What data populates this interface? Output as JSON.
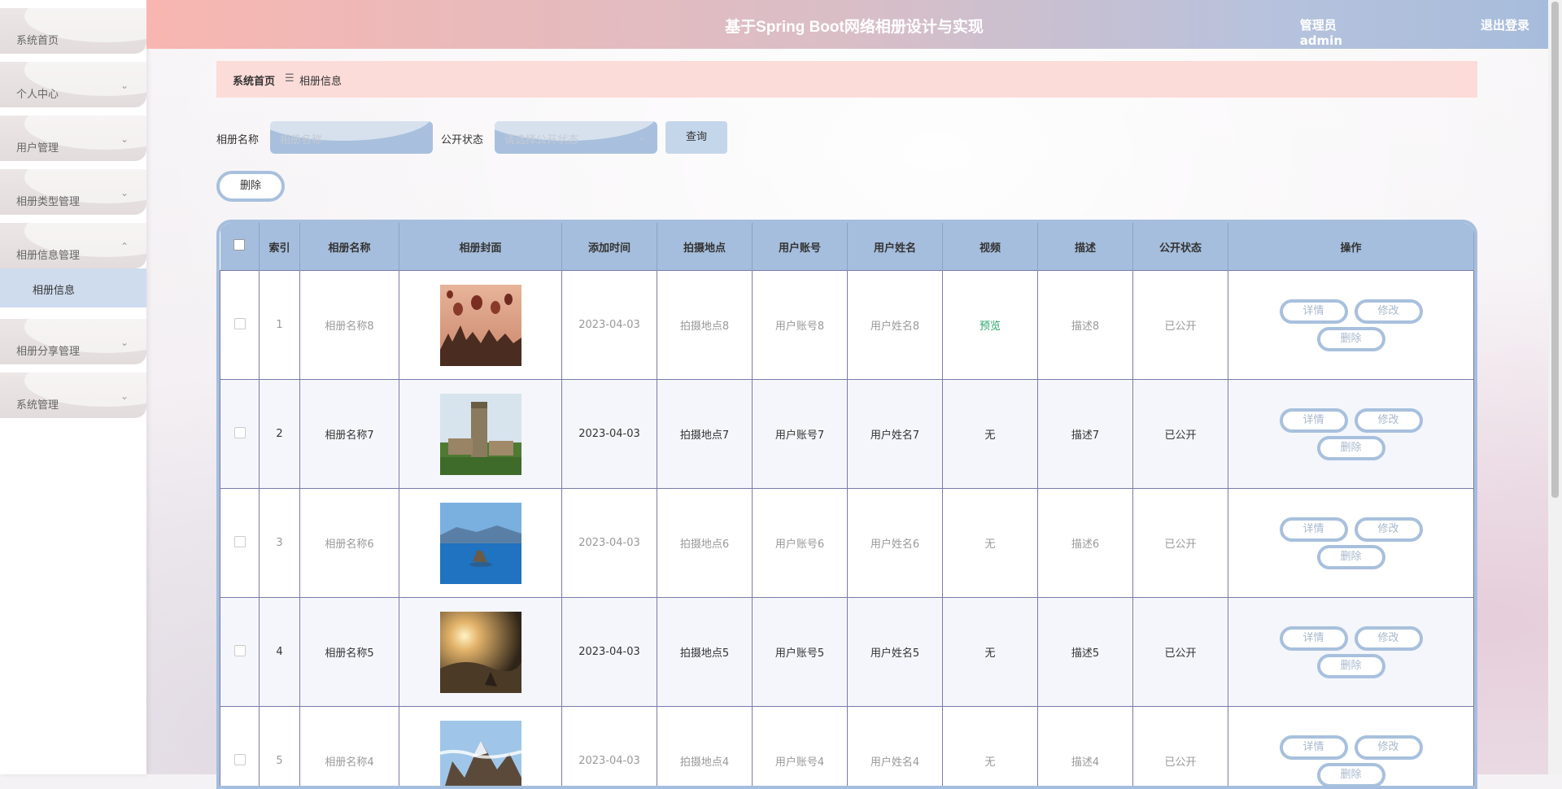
{
  "header": {
    "title": "基于Spring Boot网络相册设计与实现",
    "user": "管理员 admin",
    "logout": "退出登录"
  },
  "sidebar": {
    "items": [
      {
        "label": "系统首页",
        "chevron": ""
      },
      {
        "label": "个人中心",
        "chevron": "⌄"
      },
      {
        "label": "用户管理",
        "chevron": "⌄"
      },
      {
        "label": "相册类型管理",
        "chevron": "⌄"
      },
      {
        "label": "相册信息管理",
        "chevron": "⌃"
      },
      {
        "label": "相册分享管理",
        "chevron": "⌄"
      },
      {
        "label": "系统管理",
        "chevron": "⌄"
      }
    ],
    "sub_item": "相册信息"
  },
  "breadcrumb": {
    "home": "系统首页",
    "sep": "☰",
    "current": "相册信息"
  },
  "search": {
    "name_label": "相册名称",
    "name_placeholder": "相册名称",
    "status_label": "公开状态",
    "status_placeholder": "请选择公开状态",
    "query_button": "查询"
  },
  "toolbar": {
    "delete_button": "删除"
  },
  "table": {
    "headers": [
      "",
      "索引",
      "相册名称",
      "相册封面",
      "添加时间",
      "拍摄地点",
      "用户账号",
      "用户姓名",
      "视频",
      "描述",
      "公开状态",
      "操作"
    ],
    "rows": [
      {
        "index": "1",
        "name": "相册名称8",
        "time": "2023-04-03",
        "place": "拍摄地点8",
        "account": "用户账号8",
        "username": "用户姓名8",
        "video": "预览",
        "desc": "描述8",
        "status": "已公开",
        "cover": "balloons"
      },
      {
        "index": "2",
        "name": "相册名称7",
        "time": "2023-04-03",
        "place": "拍摄地点7",
        "account": "用户账号7",
        "username": "用户姓名7",
        "video": "无",
        "desc": "描述7",
        "status": "已公开",
        "cover": "tower"
      },
      {
        "index": "3",
        "name": "相册名称6",
        "time": "2023-04-03",
        "place": "拍摄地点6",
        "account": "用户账号6",
        "username": "用户姓名6",
        "video": "无",
        "desc": "描述6",
        "status": "已公开",
        "cover": "lake"
      },
      {
        "index": "4",
        "name": "相册名称5",
        "time": "2023-04-03",
        "place": "拍摄地点5",
        "account": "用户账号5",
        "username": "用户姓名5",
        "video": "无",
        "desc": "描述5",
        "status": "已公开",
        "cover": "sunrise"
      },
      {
        "index": "5",
        "name": "相册名称4",
        "time": "2023-04-03",
        "place": "拍摄地点4",
        "account": "用户账号4",
        "username": "用户姓名4",
        "video": "无",
        "desc": "描述4",
        "status": "已公开",
        "cover": "mountain"
      }
    ],
    "actions": {
      "detail": "详情",
      "edit": "修改",
      "delete": "删除"
    }
  }
}
